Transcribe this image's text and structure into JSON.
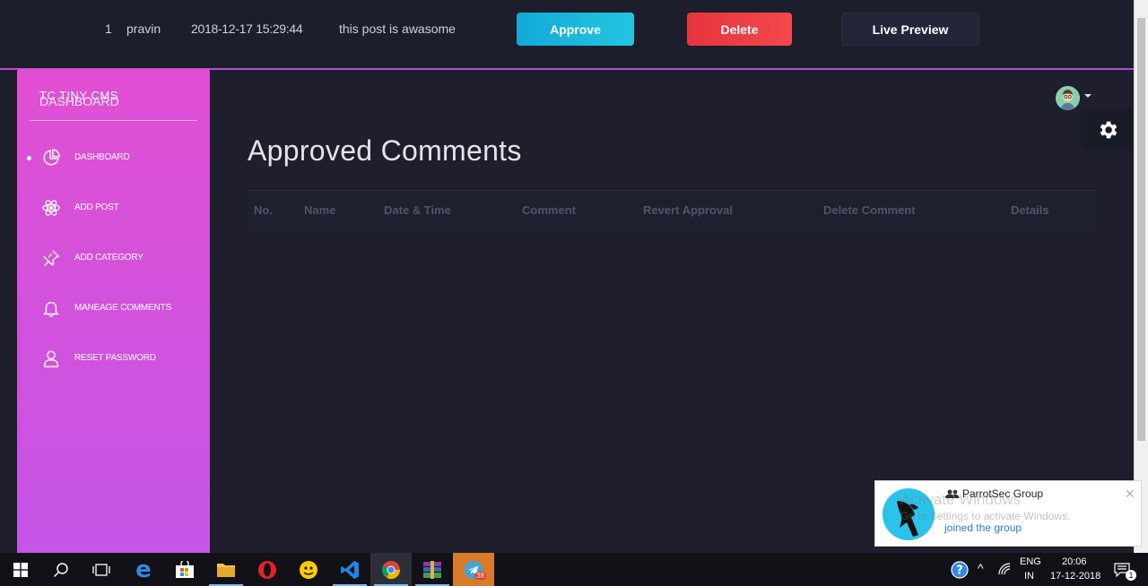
{
  "top_row": {
    "number": "1",
    "name": "pravin",
    "datetime": "2018-12-17 15:29:44",
    "comment": "this post is awasome",
    "approve_label": "Approve",
    "delete_label": "Delete",
    "live_preview_label": "Live Preview"
  },
  "sidebar": {
    "logo_mini": "TC",
    "logo_full": "TINY CMS",
    "dashboard_heading": "DASHBOARD",
    "items": [
      {
        "label": "DASHBOARD",
        "icon": "pie-chart-icon",
        "active": true
      },
      {
        "label": "ADD POST",
        "icon": "atom-icon",
        "active": false
      },
      {
        "label": "ADD CATEGORY",
        "icon": "pin-icon",
        "active": false
      },
      {
        "label": "MANEAGE COMMENTS",
        "icon": "bell-icon",
        "active": false
      },
      {
        "label": "RESET PASSWORD",
        "icon": "user-icon",
        "active": false
      }
    ]
  },
  "main": {
    "title": "Approved Comments",
    "columns": [
      "No.",
      "Name",
      "Date & Time",
      "Comment",
      "Revert Approval",
      "Delete Comment",
      "Details"
    ]
  },
  "notification": {
    "title": "ParrotSec Group",
    "body": "joined the group",
    "watermark_line1": "Activate Windows",
    "watermark_line2": "Go to Settings to activate Windows."
  },
  "taskbar": {
    "lang_top": "ENG",
    "lang_bottom": "IN",
    "time": "20:06",
    "date": "17-12-2018",
    "telegram_badge": "38",
    "notification_count": "1"
  },
  "colors": {
    "sidebar_top": "#e14fd3",
    "sidebar_bottom": "#c455e6",
    "approve": "#13a9d8",
    "delete": "#e8343c",
    "background": "#1e1e2c"
  }
}
